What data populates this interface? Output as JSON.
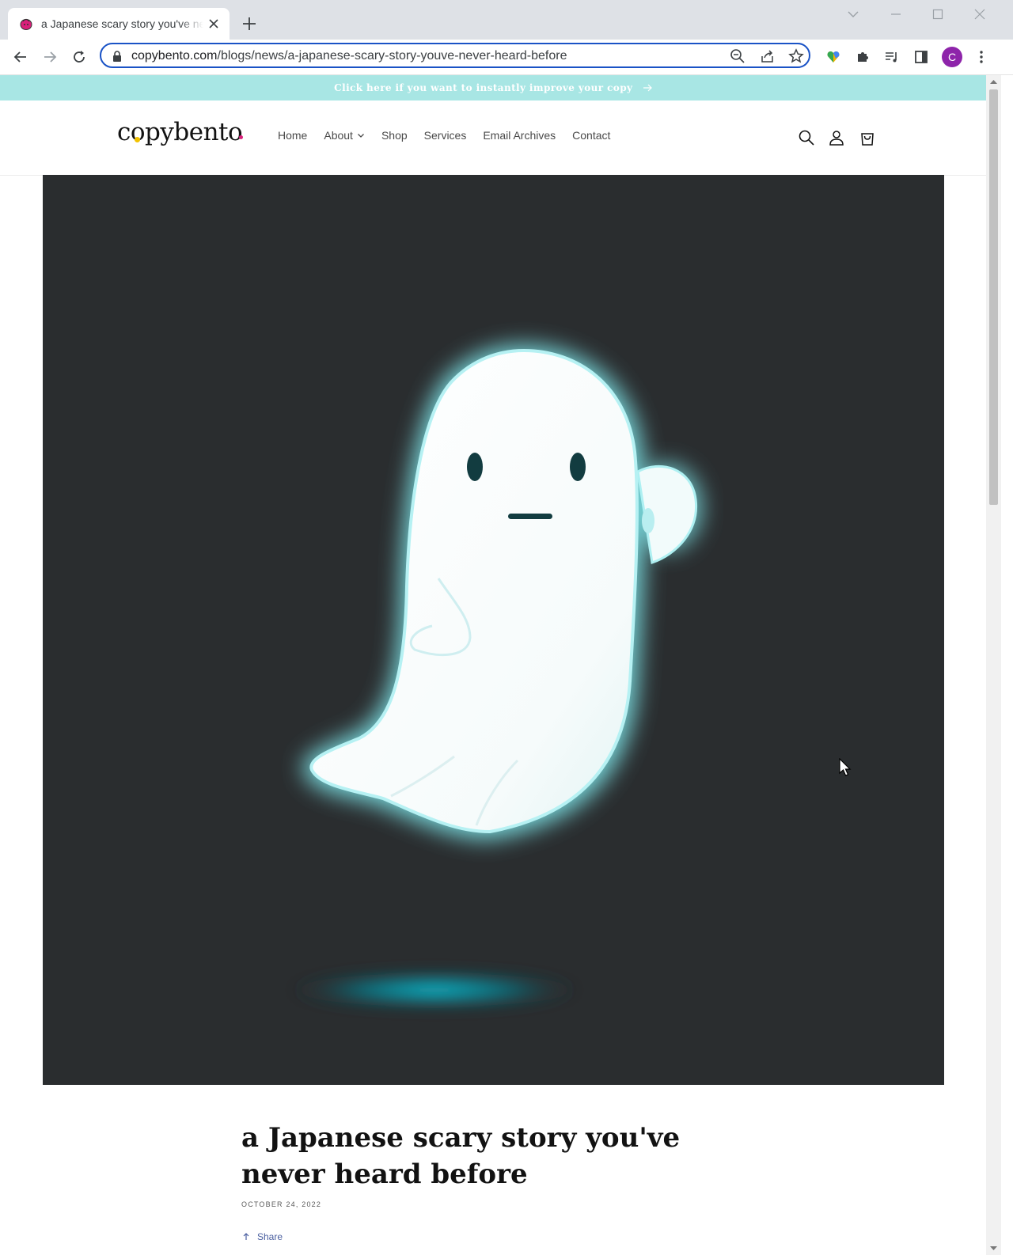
{
  "browser": {
    "tab_title": "a Japanese scary story you've never heard before",
    "url_host": "copybento.com",
    "url_path": "/blogs/news/a-japanese-scary-story-youve-never-heard-before",
    "profile_initial": "C"
  },
  "announcement": {
    "text": "Click here if you want to instantly improve your copy"
  },
  "header": {
    "logo": "copybento",
    "nav": [
      {
        "label": "Home"
      },
      {
        "label": "About"
      },
      {
        "label": "Shop"
      },
      {
        "label": "Services"
      },
      {
        "label": "Email Archives"
      },
      {
        "label": "Contact"
      }
    ]
  },
  "article": {
    "title": "a Japanese scary story you've never heard before",
    "date": "OCTOBER 24, 2022",
    "share_label": "Share"
  },
  "colors": {
    "announcement_bg": "#a8e6e4",
    "hero_bg": "#2a2d2f",
    "omnibox_border": "#1a53c6",
    "avatar": "#8e24aa"
  }
}
